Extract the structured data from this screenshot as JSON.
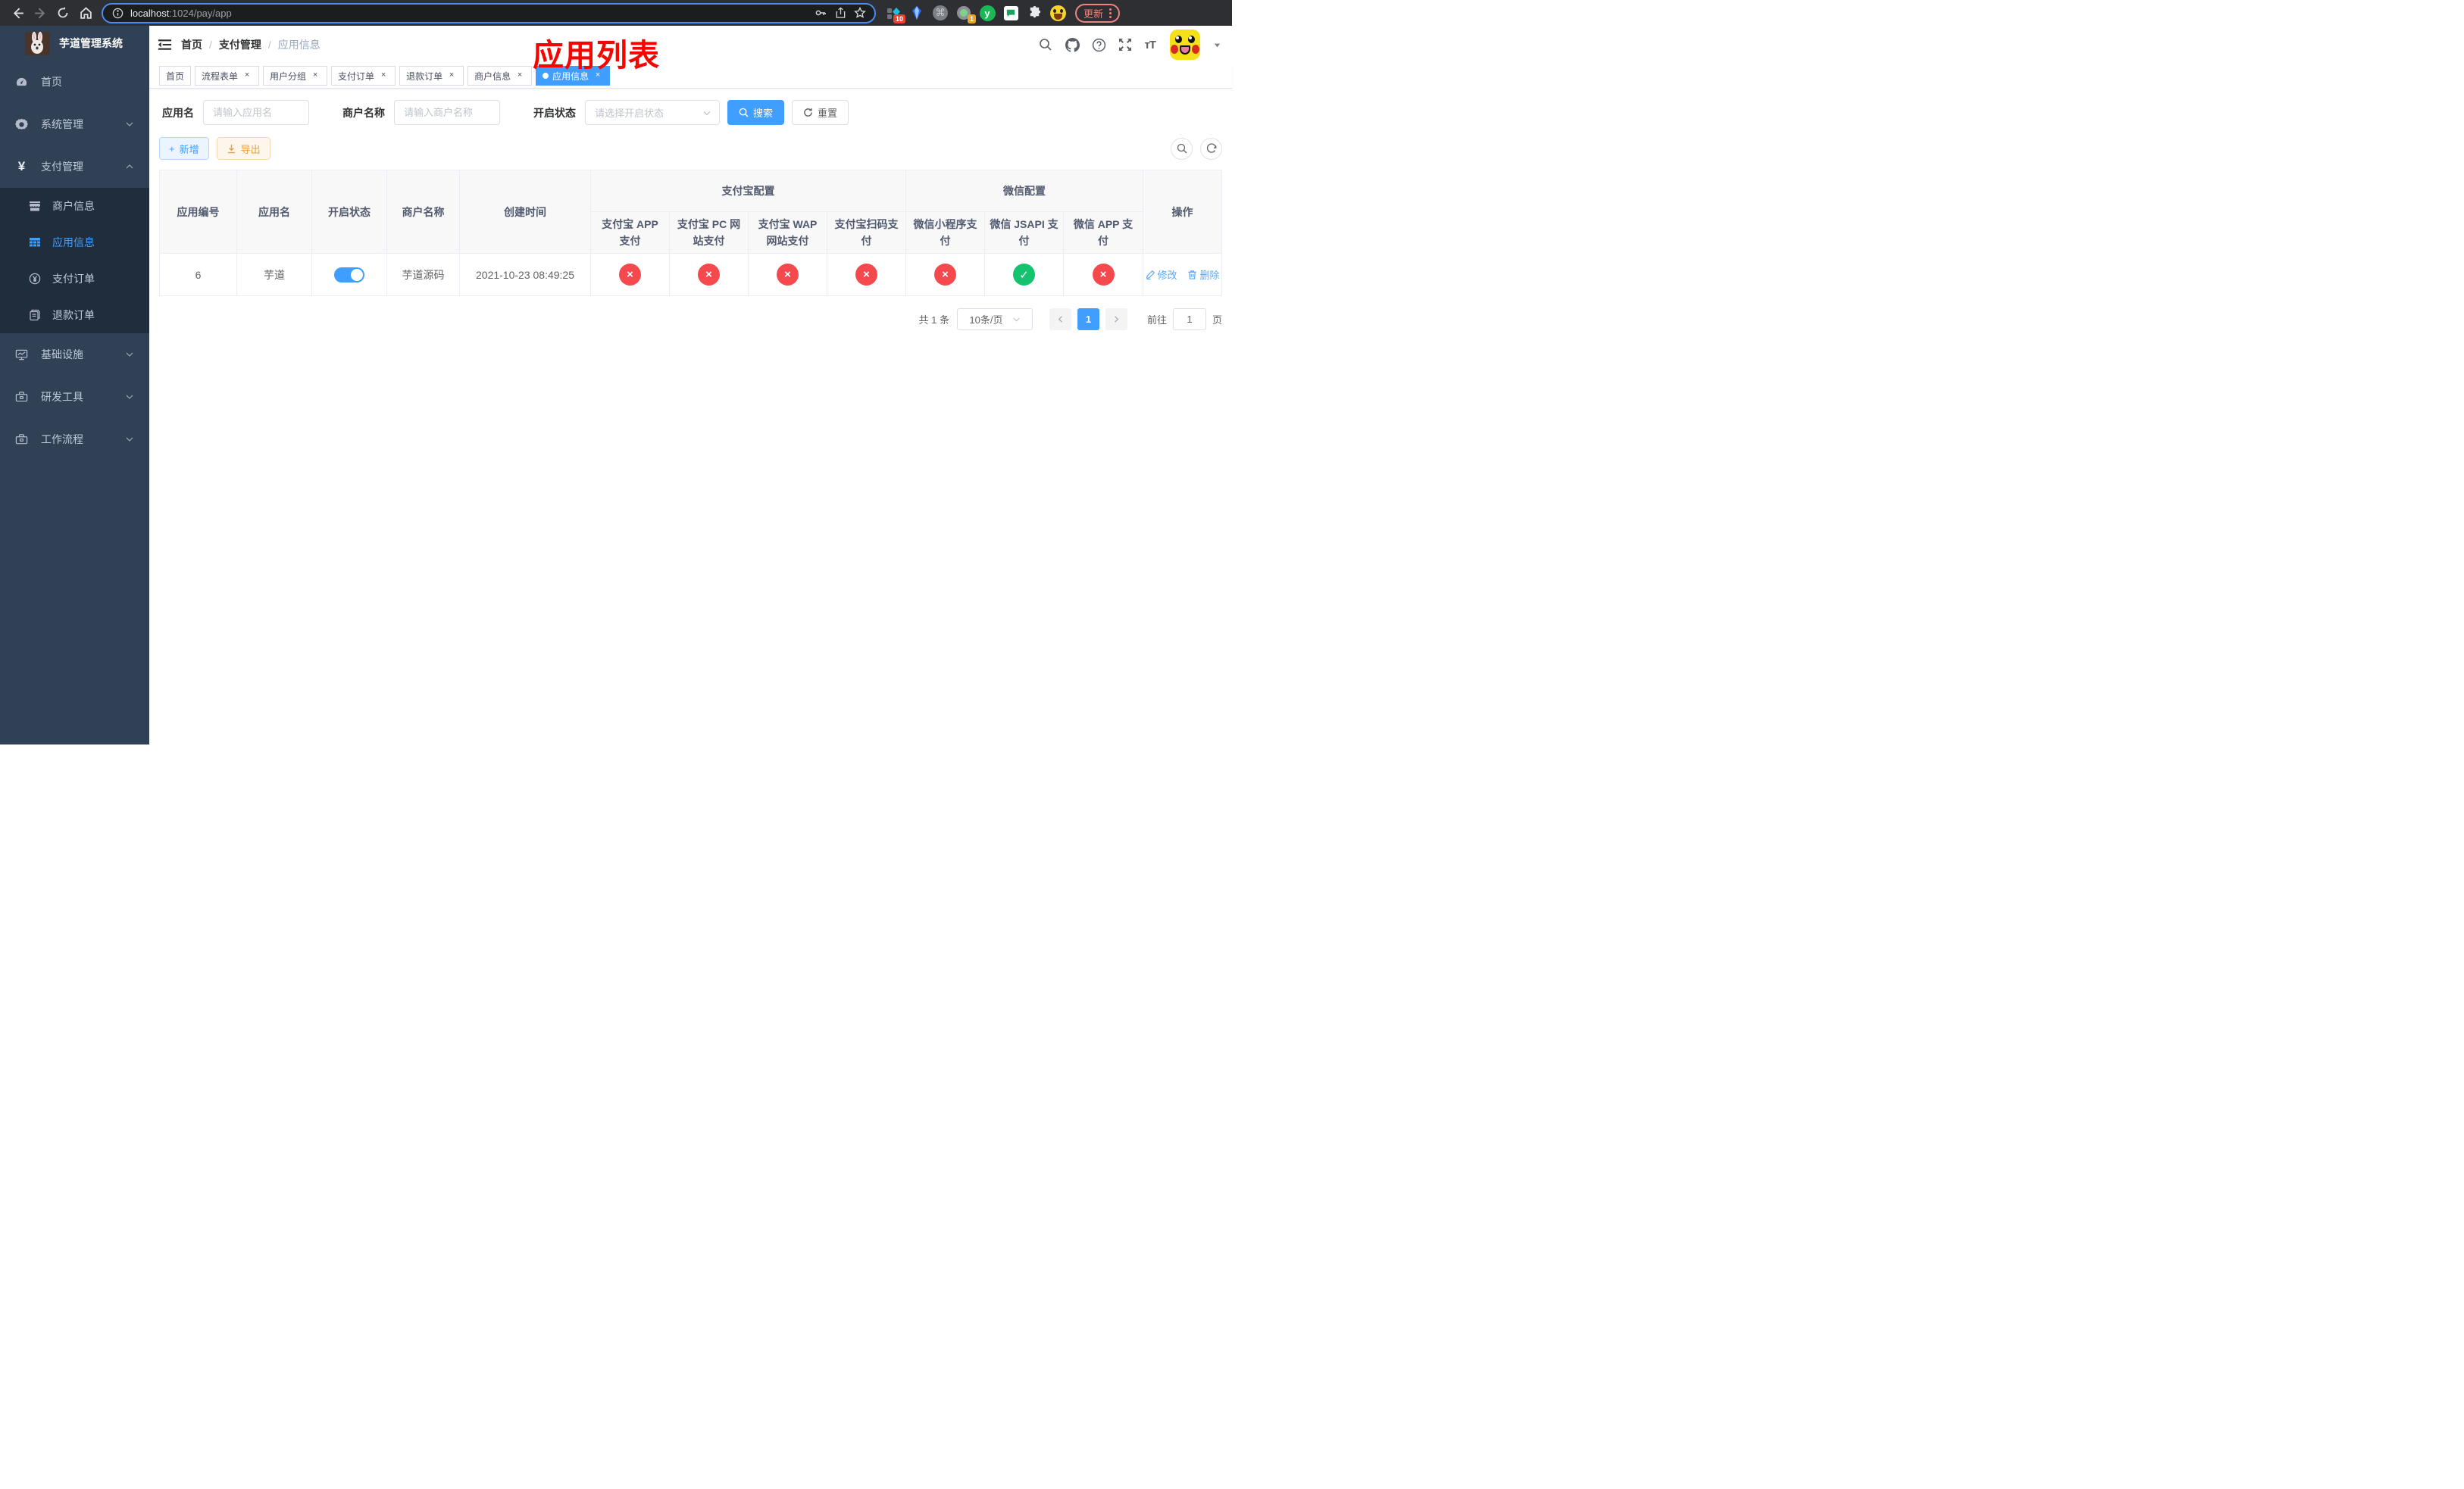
{
  "icons": {
    "close": "×",
    "check": "✓",
    "cross": "×",
    "plus": "+",
    "caret": "▾"
  },
  "browser": {
    "url_host": "localhost",
    "url_rest": ":1024/pay/app",
    "update_label": "更新",
    "ext_badge_pin": "10",
    "ext_badge_one": "1",
    "ext_y_label": "y"
  },
  "sidebar": {
    "title": "芋道管理系统",
    "home": "首页",
    "system": "系统管理",
    "payment": "支付管理",
    "merchant_info": "商户信息",
    "app_info": "应用信息",
    "pay_order": "支付订单",
    "refund_order": "退款订单",
    "infrastructure": "基础设施",
    "dev_tools": "研发工具",
    "workflow": "工作流程"
  },
  "header": {
    "breadcrumb": [
      "首页",
      "支付管理",
      "应用信息"
    ],
    "annotation": "应用列表"
  },
  "tags": [
    {
      "label": "首页"
    },
    {
      "label": "流程表单"
    },
    {
      "label": "用户分组"
    },
    {
      "label": "支付订单"
    },
    {
      "label": "退款订单"
    },
    {
      "label": "商户信息"
    },
    {
      "label": "应用信息"
    }
  ],
  "filters": {
    "app_name_label": "应用名",
    "app_name_placeholder": "请输入应用名",
    "merchant_label": "商户名称",
    "merchant_placeholder": "请输入商户名称",
    "status_label": "开启状态",
    "status_placeholder": "请选择开启状态",
    "search_label": "搜索",
    "reset_label": "重置"
  },
  "toolbar": {
    "add_label": "新增",
    "export_label": "导出"
  },
  "table": {
    "heads": {
      "app_id": "应用编号",
      "app_name": "应用名",
      "status": "开启状态",
      "merchant": "商户名称",
      "created": "创建时间",
      "alipay_group": "支付宝配置",
      "wechat_group": "微信配置",
      "actions": "操作",
      "sub": [
        "支付宝 APP 支付",
        "支付宝 PC 网站支付",
        "支付宝 WAP 网站支付",
        "支付宝扫码支付",
        "微信小程序支付",
        "微信 JSAPI 支付",
        "微信 APP 支付"
      ]
    },
    "row": {
      "app_id": "6",
      "app_name": "芋道",
      "enabled": true,
      "merchant": "芋道源码",
      "created": "2021-10-23 08:49:25",
      "statuses": [
        false,
        false,
        false,
        false,
        false,
        true,
        false
      ],
      "edit_label": "修改",
      "delete_label": "删除"
    }
  },
  "pagination": {
    "total": "共 1 条",
    "page_size": "10条/页",
    "current": "1",
    "goto_prefix": "前往",
    "goto_value": "1",
    "goto_suffix": "页"
  }
}
